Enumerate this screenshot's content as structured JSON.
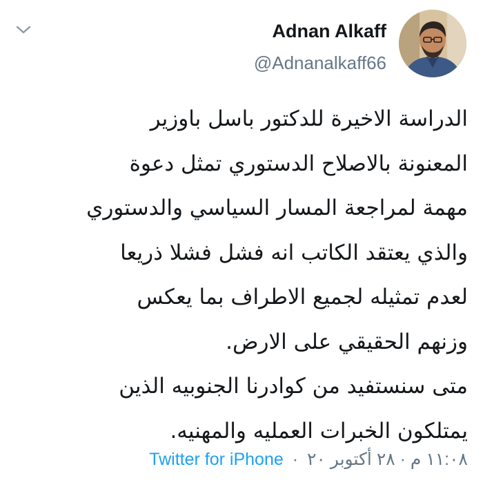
{
  "author": {
    "display_name": "Adnan Alkaff",
    "handle": "@Adnanalkaff66"
  },
  "tweet": {
    "lines": [
      "الدراسة الاخيرة للدكتور باسل باوزير",
      "المعنونة بالاصلاح الدستوري تمثل دعوة",
      "مهمة لمراجعة المسار السياسي والدستوري",
      "والذي يعتقد الكاتب انه فشل فشلا ذريعا",
      "لعدم تمثيله لجميع الاطراف بما يعكس",
      "وزنهم الحقيقي على الارض.",
      "متى سنستفيد من كوادرنا الجنوبيه الذين",
      "يمتلكون الخبرات العمليه والمهنيه."
    ]
  },
  "meta": {
    "timestamp": "١١:٠٨ م · ٢٨ أكتوبر ٢٠",
    "separator": "·",
    "source": "Twitter for iPhone"
  },
  "colors": {
    "link_blue": "#1da1f2",
    "secondary_gray": "#657786",
    "text_dark": "#14171a"
  },
  "icons": {
    "menu": "chevron-down-icon",
    "avatar": "profile-photo"
  }
}
